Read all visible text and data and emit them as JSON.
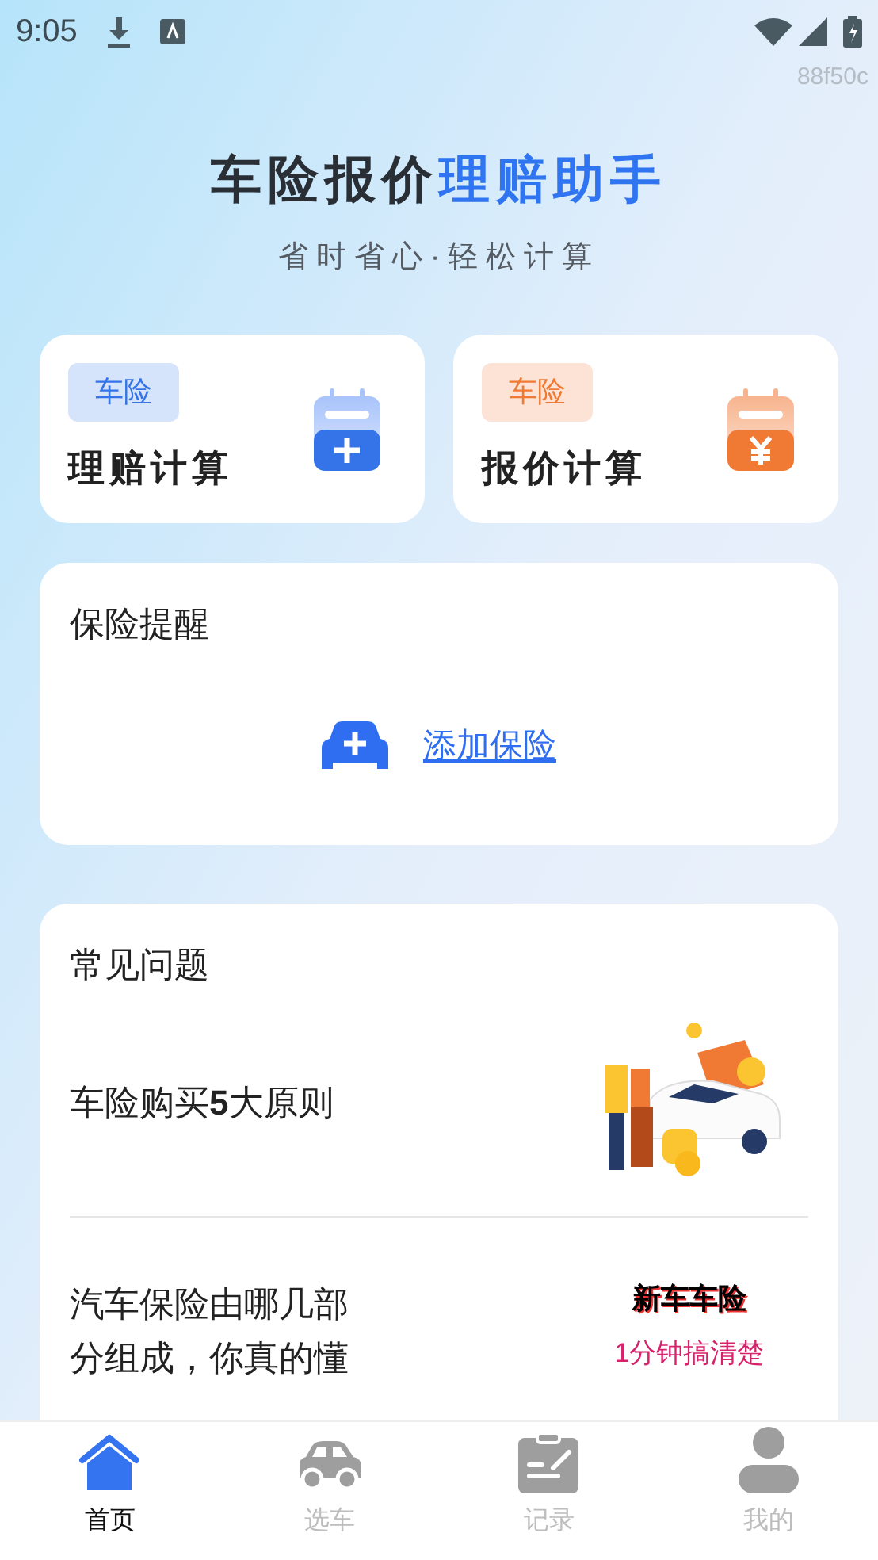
{
  "status_bar": {
    "time": "9:05",
    "code": "88f50c"
  },
  "header": {
    "title": "车险报价",
    "title_highlight": "理赔助手",
    "subtitle": "省时省心·轻松计算"
  },
  "tools": [
    {
      "tag": "车险",
      "label": "理赔计算",
      "kind": "claim"
    },
    {
      "tag": "车险",
      "label": "报价计算",
      "kind": "quote"
    }
  ],
  "reminder": {
    "title": "保险提醒",
    "link": "添加保险"
  },
  "faq": {
    "title": "常见问题",
    "items": [
      {
        "text": "车险购买**5**大原则"
      },
      {
        "text": "汽车保险由哪几部分组成，你真的懂",
        "thumb": {
          "kind": "text",
          "headline": "新车车险",
          "caption": "1分钟搞清楚"
        }
      }
    ]
  },
  "tab_bar": [
    {
      "label": "首页",
      "kind": "home",
      "selected": true
    },
    {
      "label": "选车",
      "kind": "car",
      "selected": false
    },
    {
      "label": "记录",
      "kind": "clipboard",
      "selected": false
    },
    {
      "label": "我的",
      "kind": "person",
      "selected": false
    }
  ]
}
